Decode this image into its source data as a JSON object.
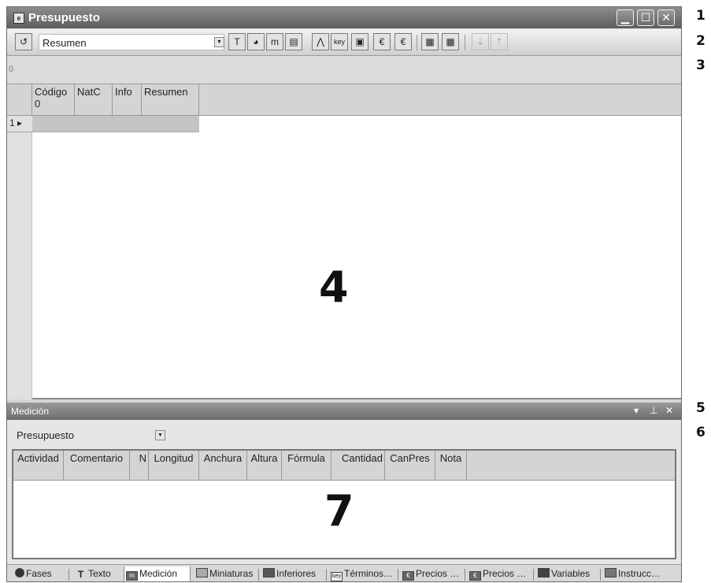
{
  "window": {
    "title": "Presupuesto",
    "icon": "document-icon",
    "controls": [
      "minimize",
      "maximize",
      "close"
    ]
  },
  "toolbar": {
    "view_select_value": "Resumen",
    "buttons": [
      "undo-icon",
      "text-icon",
      "globe-icon",
      "measurement-icon",
      "thumbnails-icon",
      "tree-icon",
      "key-icon",
      "image-icon",
      "euro-price-icon",
      "euro-price-2-icon",
      "table-icon",
      "table-2-icon",
      "move-down-icon",
      "move-up-icon"
    ]
  },
  "formula_bar": {
    "value": "0"
  },
  "main_grid": {
    "columns": [
      {
        "label": "Código",
        "sub": "0"
      },
      {
        "label": "NatC",
        "sub": ""
      },
      {
        "label": "Info",
        "sub": ""
      },
      {
        "label": "Resumen",
        "sub": ""
      }
    ],
    "rows": [
      {
        "num": "1 ▸"
      }
    ]
  },
  "medicion_panel": {
    "title": "Medición",
    "select_value": "Presupuesto",
    "columns": [
      "Actividad",
      "Comentario",
      "N",
      "Longitud",
      "Anchura",
      "Altura",
      "Fórmula",
      "Cantidad",
      "CanPres",
      "Nota"
    ]
  },
  "tabs": [
    {
      "label": "Fases",
      "icon": "globe-icon"
    },
    {
      "label": "Texto",
      "icon": "text-icon"
    },
    {
      "label": "Medición",
      "icon": "measurement-icon",
      "active": true
    },
    {
      "label": "Miniaturas",
      "icon": "thumbnails-icon"
    },
    {
      "label": "Inferiores",
      "icon": "tree-icon"
    },
    {
      "label": "Términos…",
      "icon": "key-icon"
    },
    {
      "label": "Precios …",
      "icon": "euro-price-icon"
    },
    {
      "label": "Precios …",
      "icon": "euro-price-2-icon"
    },
    {
      "label": "Variables",
      "icon": "table-icon"
    },
    {
      "label": "Instrucc…",
      "icon": "table-2-icon"
    }
  ],
  "callouts": {
    "c1": "1",
    "c2": "2",
    "c3": "3",
    "c4": "4",
    "c5": "5",
    "c6": "6",
    "c7": "7"
  },
  "colors": {
    "titlebar": "#6e6e6e",
    "panel_bg": "#d6d6d6",
    "selected_row": "#c4c4c4"
  }
}
